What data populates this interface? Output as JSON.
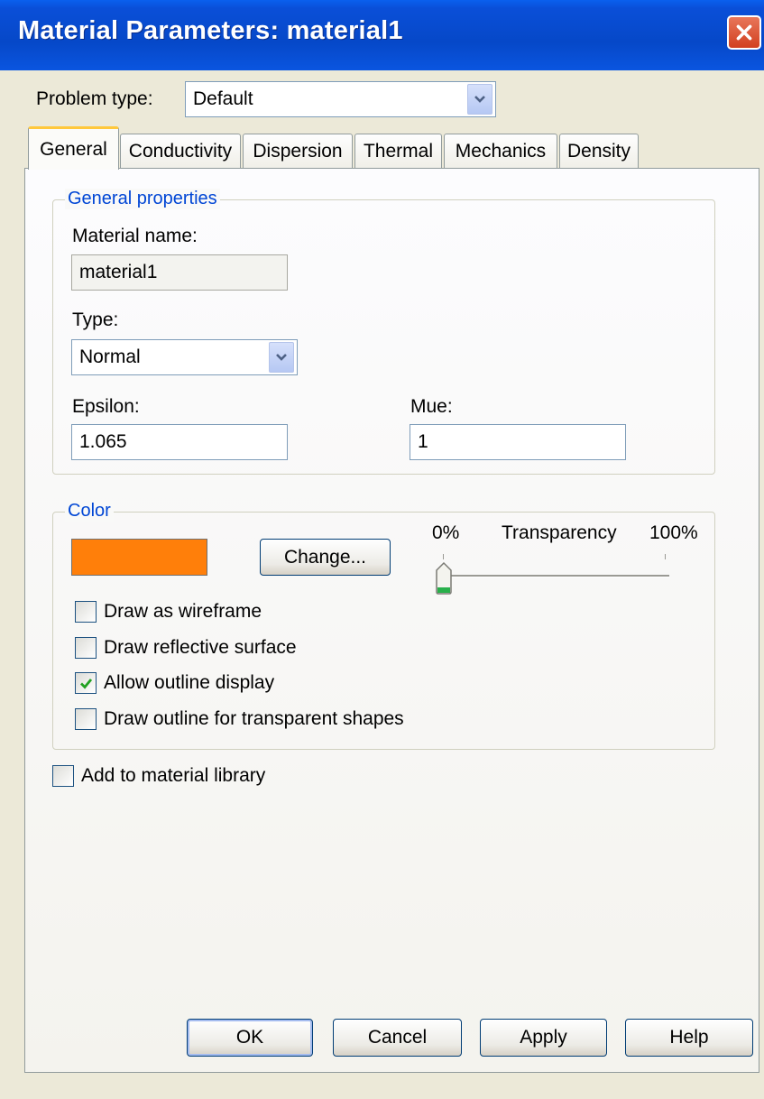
{
  "window": {
    "title": "Material Parameters: material1"
  },
  "problem_type": {
    "label": "Problem type:",
    "value": "Default"
  },
  "tabs": [
    {
      "label": "General",
      "active": true
    },
    {
      "label": "Conductivity"
    },
    {
      "label": "Dispersion"
    },
    {
      "label": "Thermal"
    },
    {
      "label": "Mechanics"
    },
    {
      "label": "Density"
    }
  ],
  "general_properties": {
    "group_title": "General properties",
    "material_name_label": "Material name:",
    "material_name_value": "material1",
    "type_label": "Type:",
    "type_value": "Normal",
    "epsilon_label": "Epsilon:",
    "epsilon_value": "1.065",
    "mue_label": "Mue:",
    "mue_value": "1"
  },
  "color": {
    "group_title": "Color",
    "swatch_color": "#ff7f0a",
    "change_button": "Change...",
    "transparency": {
      "label": "Transparency",
      "min_label": "0%",
      "max_label": "100%",
      "value_percent": 0
    },
    "checkboxes": [
      {
        "label": "Draw as wireframe",
        "checked": false
      },
      {
        "label": "Draw reflective surface",
        "checked": false
      },
      {
        "label": "Allow outline display",
        "checked": true
      },
      {
        "label": "Draw outline for transparent shapes",
        "checked": false
      }
    ]
  },
  "add_to_library": {
    "label": "Add to material library",
    "checked": false
  },
  "buttons": {
    "ok": "OK",
    "cancel": "Cancel",
    "apply": "Apply",
    "help": "Help"
  },
  "icons": {
    "close": "close-icon",
    "dropdown": "chevron-down-icon",
    "check": "checkmark-icon"
  }
}
